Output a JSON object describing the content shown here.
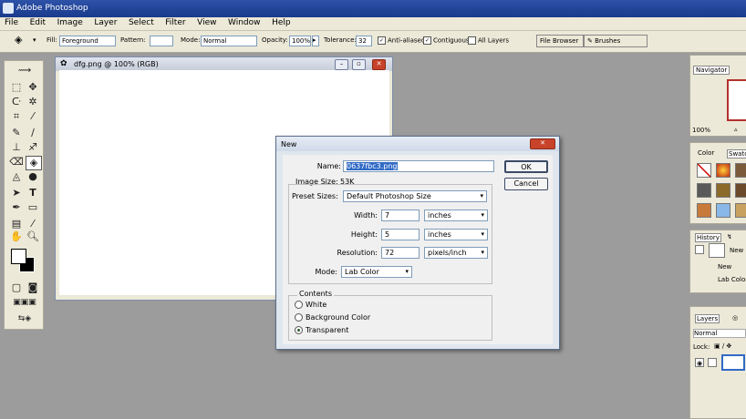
{
  "app": {
    "title": "Adobe Photoshop"
  },
  "menu": [
    "File",
    "Edit",
    "Image",
    "Layer",
    "Select",
    "Filter",
    "View",
    "Window",
    "Help"
  ],
  "options_bar": {
    "fill_label": "Fill:",
    "fill_value": "Foreground",
    "pattern_label": "Pattern:",
    "mode_label": "Mode:",
    "mode_value": "Normal",
    "opacity_label": "Opacity:",
    "opacity_value": "100%",
    "tolerance_label": "Tolerance:",
    "tolerance_value": "32",
    "anti_aliased": "Anti-aliased",
    "contiguous": "Contiguous",
    "all_layers": "All Layers",
    "file_browser": "File Browser",
    "brushes": "Brushes"
  },
  "document": {
    "title": "dfg.png @ 100% (RGB)"
  },
  "dialog": {
    "title": "New",
    "name_label": "Name:",
    "name_value": "0637fbc3.png",
    "image_size_label": "Image Size:",
    "image_size_value": "53K",
    "preset_label": "Preset Sizes:",
    "preset_value": "Default Photoshop Size",
    "width_label": "Width:",
    "width_value": "7",
    "width_unit": "inches",
    "height_label": "Height:",
    "height_value": "5",
    "height_unit": "inches",
    "resolution_label": "Resolution:",
    "resolution_value": "72",
    "resolution_unit": "pixels/inch",
    "mode_label": "Mode:",
    "mode_value": "Lab Color",
    "contents_label": "Contents",
    "radio_white": "White",
    "radio_background": "Background Color",
    "radio_transparent": "Transparent",
    "selected_content": "Transparent",
    "ok_label": "OK",
    "cancel_label": "Cancel"
  },
  "panels": {
    "navigator": "Navigator",
    "zoom": "100%",
    "color_tab": "Color",
    "swatches_tab": "Swatches",
    "history_tab": "History",
    "history_new": "New",
    "history_item1": "New",
    "history_item2": "Lab Color",
    "layers_tab": "Layers",
    "layers_mode": "Normal",
    "lock_label": "Lock:"
  },
  "colors": {
    "titlebar": "#1a3a8c",
    "workspace": "#9c9c9c",
    "panel": "#ece9d8",
    "close_button": "#c8432a"
  }
}
